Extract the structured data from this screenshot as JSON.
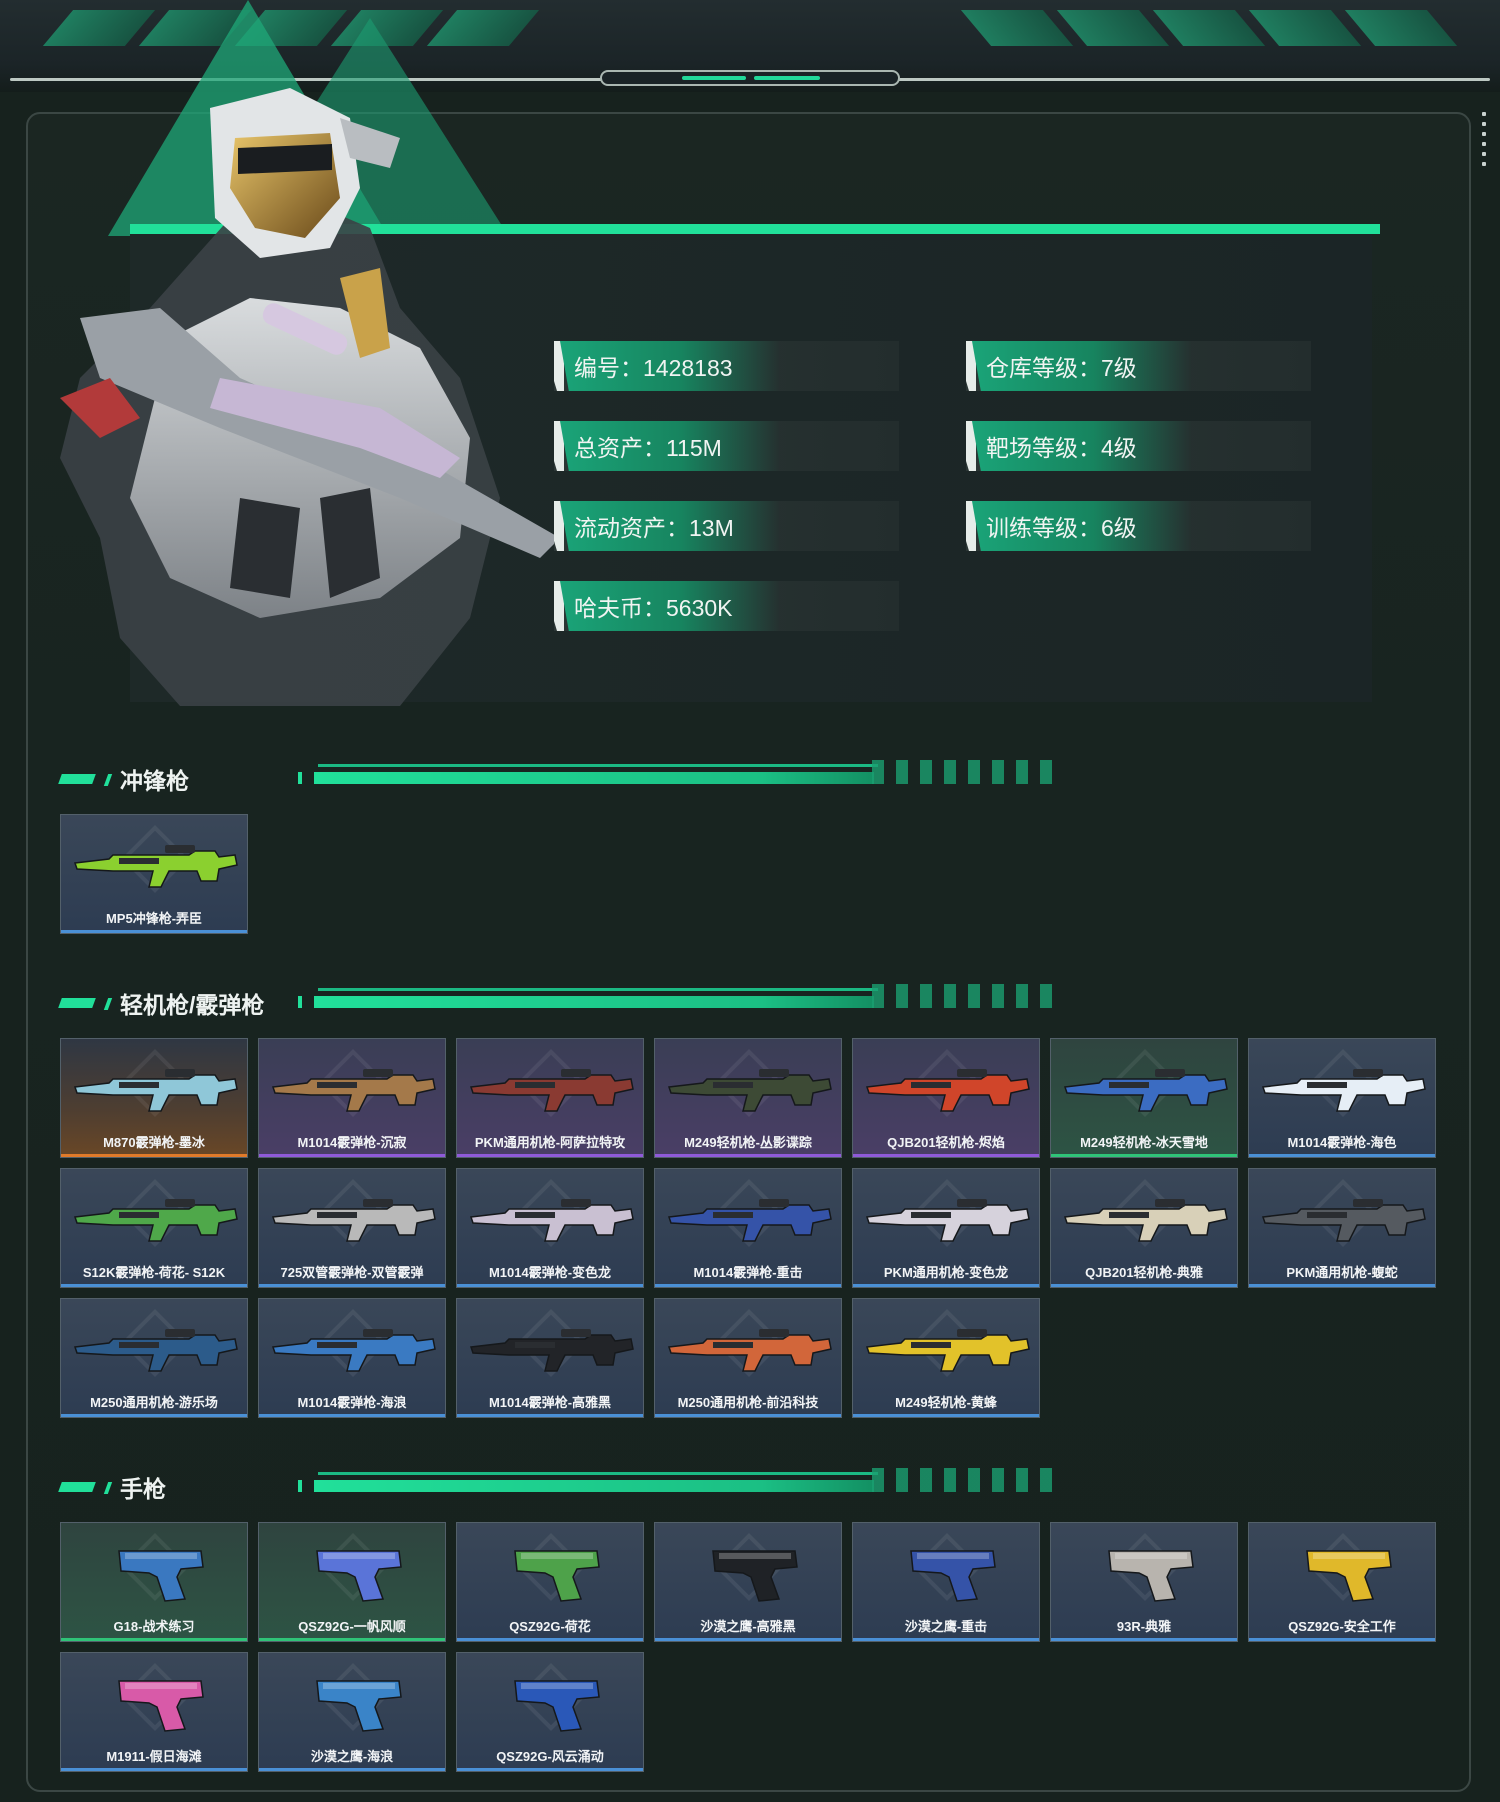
{
  "profile": {
    "stats": [
      {
        "label": "编号：1428183"
      },
      {
        "label": "仓库等级：7级"
      },
      {
        "label": "总资产：115M"
      },
      {
        "label": "靶场等级：4级"
      },
      {
        "label": "流动资产：13M"
      },
      {
        "label": "训练等级：6级"
      },
      {
        "label": "哈夫币：5630K"
      }
    ]
  },
  "sections": [
    {
      "title": "冲锋枪",
      "items": [
        {
          "name": "MP5冲锋枪-弄臣",
          "rarity": "blue",
          "color": "#8bd02f"
        }
      ]
    },
    {
      "title": "轻机枪/霰弹枪",
      "items": [
        {
          "name": "M870霰弹枪-墨冰",
          "rarity": "orange",
          "color": "#8fc7d8"
        },
        {
          "name": "M1014霰弹枪-沉寂",
          "rarity": "purple",
          "color": "#a4794a"
        },
        {
          "name": "PKM通用机枪-阿萨拉特攻",
          "rarity": "purple",
          "color": "#8a3a32"
        },
        {
          "name": "M249轻机枪-丛影谍踪",
          "rarity": "purple",
          "color": "#3d4a35"
        },
        {
          "name": "QJB201轻机枪-烬焰",
          "rarity": "purple",
          "color": "#d0452a"
        },
        {
          "name": "M249轻机枪-冰天雪地",
          "rarity": "green",
          "color": "#3b6cc2"
        },
        {
          "name": "M1014霰弹枪-海色",
          "rarity": "blue",
          "color": "#e6eef6"
        },
        {
          "name": "S12K霰弹枪-荷花- S12K",
          "rarity": "blue",
          "color": "#4fa84a"
        },
        {
          "name": "725双管霰弹枪-双管霰弹",
          "rarity": "blue",
          "color": "#b9b9b9"
        },
        {
          "name": "M1014霰弹枪-变色龙",
          "rarity": "blue",
          "color": "#c9c0d2"
        },
        {
          "name": "M1014霰弹枪-重击",
          "rarity": "blue",
          "color": "#3553a8"
        },
        {
          "name": "PKM通用机枪-变色龙",
          "rarity": "blue",
          "color": "#d6d2dc"
        },
        {
          "name": "QJB201轻机枪-典雅",
          "rarity": "blue",
          "color": "#d8d0b8"
        },
        {
          "name": "PKM通用机枪-蝮蛇",
          "rarity": "blue",
          "color": "#555a60"
        },
        {
          "name": "M250通用机枪-游乐场",
          "rarity": "blue",
          "color": "#2c5b8a"
        },
        {
          "name": "M1014霰弹枪-海浪",
          "rarity": "blue",
          "color": "#3a7ac2"
        },
        {
          "name": "M1014霰弹枪-高雅黑",
          "rarity": "blue",
          "color": "#222428"
        },
        {
          "name": "M250通用机枪-前沿科技",
          "rarity": "blue",
          "color": "#d2663a"
        },
        {
          "name": "M249轻机枪-黄蜂",
          "rarity": "blue",
          "color": "#e2c22a"
        }
      ]
    },
    {
      "title": "手枪",
      "items": [
        {
          "name": "G18-战术练习",
          "rarity": "green",
          "color": "#3a78c0"
        },
        {
          "name": "QSZ92G-一帆风顺",
          "rarity": "green",
          "color": "#5a74d8"
        },
        {
          "name": "QSZ92G-荷花",
          "rarity": "blue",
          "color": "#4ea24a"
        },
        {
          "name": "沙漠之鹰-高雅黑",
          "rarity": "blue",
          "color": "#1f2226"
        },
        {
          "name": "沙漠之鹰-重击",
          "rarity": "blue",
          "color": "#3553a8"
        },
        {
          "name": "93R-典雅",
          "rarity": "blue",
          "color": "#b8b4ae"
        },
        {
          "name": "QSZ92G-安全工作",
          "rarity": "blue",
          "color": "#e0b82a"
        },
        {
          "name": "M1911-假日海滩",
          "rarity": "blue",
          "color": "#d85aa8"
        },
        {
          "name": "沙漠之鹰-海浪",
          "rarity": "blue",
          "color": "#3a84c8"
        },
        {
          "name": "QSZ92G-风云涌动",
          "rarity": "blue",
          "color": "#2a58b8"
        }
      ]
    }
  ]
}
